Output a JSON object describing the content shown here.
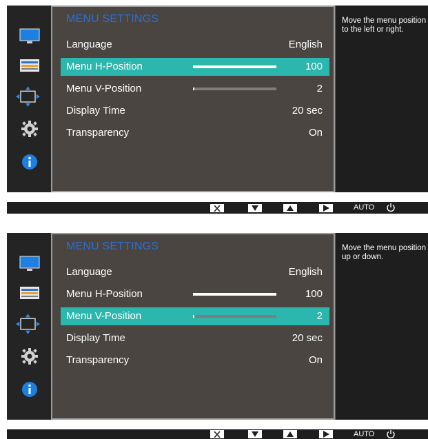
{
  "panels": [
    {
      "menu_title": "MENU SETTINGS",
      "rows": [
        {
          "label": "Language",
          "value": "English",
          "bar_fraction": null,
          "selected": false
        },
        {
          "label": "Menu H-Position",
          "value": "100",
          "bar_fraction": 1.0,
          "selected": true
        },
        {
          "label": "Menu V-Position",
          "value": "2",
          "bar_fraction": 0.02,
          "selected": false
        },
        {
          "label": "Display Time",
          "value": "20 sec",
          "bar_fraction": null,
          "selected": false
        },
        {
          "label": "Transparency",
          "value": "On",
          "bar_fraction": null,
          "selected": false
        }
      ],
      "help_text": "Move the menu position to the left or right."
    },
    {
      "menu_title": "MENU SETTINGS",
      "rows": [
        {
          "label": "Language",
          "value": "English",
          "bar_fraction": null,
          "selected": false
        },
        {
          "label": "Menu H-Position",
          "value": "100",
          "bar_fraction": 1.0,
          "selected": false
        },
        {
          "label": "Menu V-Position",
          "value": "2",
          "bar_fraction": 0.02,
          "selected": true
        },
        {
          "label": "Display Time",
          "value": "20 sec",
          "bar_fraction": null,
          "selected": false
        },
        {
          "label": "Transparency",
          "value": "On",
          "bar_fraction": null,
          "selected": false
        }
      ],
      "help_text": "Move the menu position up or down."
    }
  ],
  "sidebar_icons": [
    "picture-icon",
    "color-icon",
    "onscreen-display-icon",
    "system-gear-icon",
    "information-icon"
  ],
  "buttons": {
    "auto_label": "AUTO"
  },
  "colors": {
    "title": "#2a6fd9",
    "selected_row": "#2bb7ad",
    "panel": "#4a4540",
    "background": "#1e1e1e"
  }
}
